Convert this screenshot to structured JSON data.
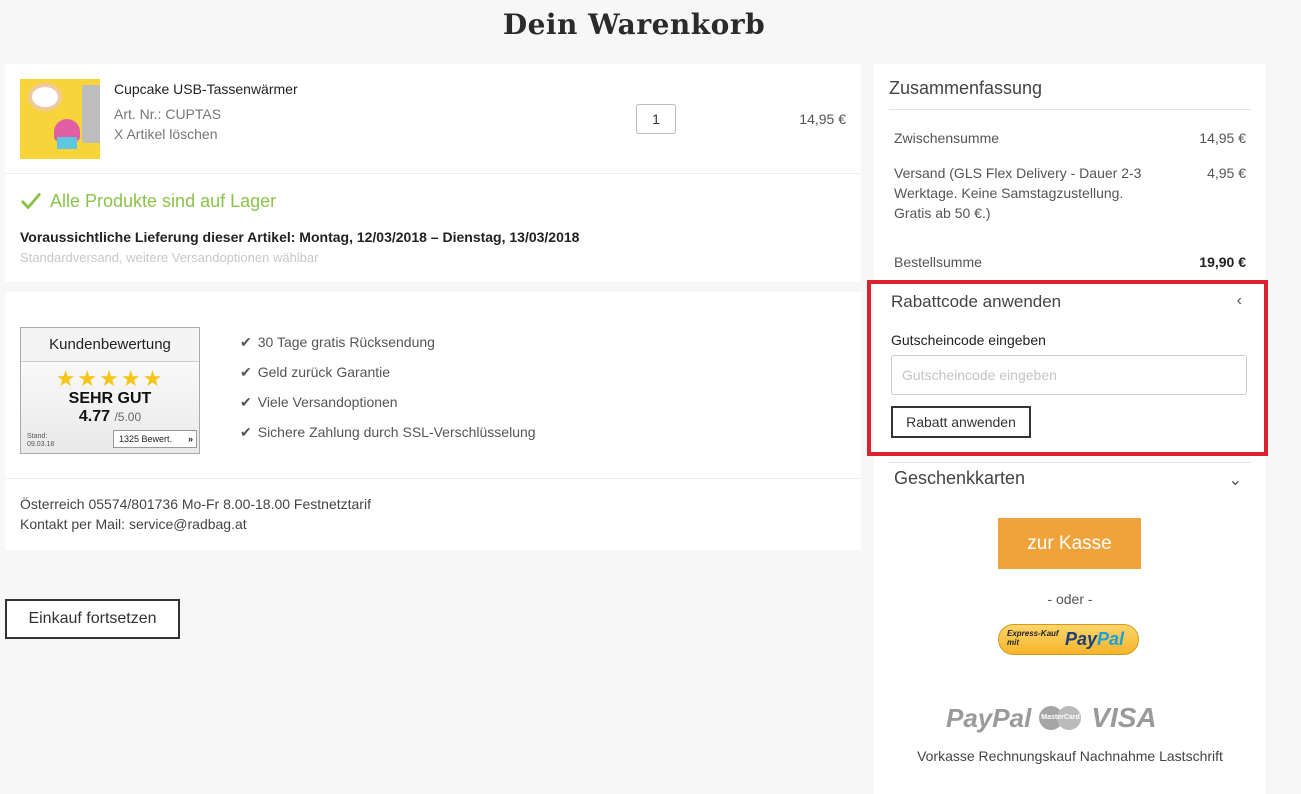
{
  "page": {
    "title": "Dein Warenkorb"
  },
  "cart": {
    "item": {
      "name": "Cupcake USB-Tassenwärmer",
      "sku": "Art. Nr.: CUPTAS",
      "delete_label": "X  Artikel löschen",
      "quantity": "1",
      "price": "14,95 €"
    },
    "stock_text": "Alle Produkte sind auf Lager",
    "delivery_text": "Voraussichtliche Lieferung dieser Artikel: Montag, 12/03/2018 – Dienstag, 13/03/2018",
    "delivery_sub": "Standardversand, weitere Versandoptionen wählbar"
  },
  "rating": {
    "header": "Kundenbewertung",
    "stars": "★★★★★",
    "word": "SEHR GUT",
    "score": "4.77",
    "max": "/5.00",
    "stand_label": "Stand:",
    "stand_date": "09.03.18",
    "count": "1325 Bewert.",
    "count_arrow": "»"
  },
  "benefits": [
    "30 Tage gratis Rücksendung",
    "Geld zurück Garantie",
    "Viele Versandoptionen",
    "Sichere Zahlung durch SSL-Verschlüsselung"
  ],
  "contact": {
    "phone": "Österreich 05574/801736 Mo-Fr 8.00-18.00 Festnetztarif",
    "mail": "Kontakt per Mail: service@radbag.at"
  },
  "continue_label": "Einkauf fortsetzen",
  "summary": {
    "title": "Zusammenfassung",
    "subtotal_label": "Zwischensumme",
    "subtotal_value": "14,95 €",
    "shipping_label": "Versand (GLS Flex Delivery - Dauer 2-3 Werktage. Keine Samstagzustellung. Gratis ab 50 €.)",
    "shipping_value": "4,95 €",
    "total_label": "Bestellsumme",
    "total_value": "19,90 €"
  },
  "coupon": {
    "title": "Rabattcode anwenden",
    "chevron": "‹",
    "label": "Gutscheincode eingeben",
    "placeholder": "Gutscheincode eingeben",
    "button": "Rabatt anwenden"
  },
  "gift": {
    "title": "Geschenkkarten",
    "chevron": "⌄"
  },
  "checkout": {
    "button": "zur Kasse",
    "or": "- oder -",
    "paypal_express_small": "Express-Kauf mit",
    "paypal_express_logo_a": "Pay",
    "paypal_express_logo_b": "Pal"
  },
  "payment": {
    "paypal": "PayPal",
    "mastercard": "MasterCard",
    "visa": "VISA",
    "methods": "Vorkasse Rechnungskauf Nachnahme Lastschrift"
  },
  "colors": {
    "accent": "#f0a33a",
    "success": "#8bc34a",
    "highlight": "#d9232e",
    "star": "#f5c518"
  }
}
